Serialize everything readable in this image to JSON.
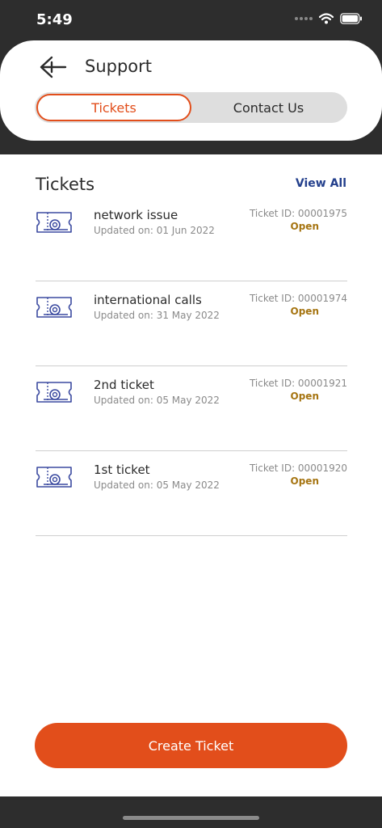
{
  "status_bar": {
    "time": "5:49"
  },
  "header": {
    "title": "Support",
    "tabs": [
      {
        "label": "Tickets",
        "active": true
      },
      {
        "label": "Contact Us",
        "active": false
      }
    ]
  },
  "tickets_section": {
    "title": "Tickets",
    "view_all_label": "View All",
    "items": [
      {
        "title": "network issue",
        "updated": "Updated on: 01 Jun 2022",
        "id": "Ticket ID: 00001975",
        "status": "Open"
      },
      {
        "title": "international calls",
        "updated": "Updated on: 31 May 2022",
        "id": "Ticket ID: 00001974",
        "status": "Open"
      },
      {
        "title": "2nd ticket",
        "updated": "Updated on: 05 May 2022",
        "id": "Ticket ID: 00001921",
        "status": "Open"
      },
      {
        "title": "1st ticket",
        "updated": "Updated on: 05 May 2022",
        "id": "Ticket ID: 00001920",
        "status": "Open"
      }
    ]
  },
  "actions": {
    "create_ticket_label": "Create Ticket"
  },
  "colors": {
    "accent": "#e24e1b",
    "link": "#233f8c",
    "status_open": "#a67512",
    "icon": "#3b4aa0"
  }
}
